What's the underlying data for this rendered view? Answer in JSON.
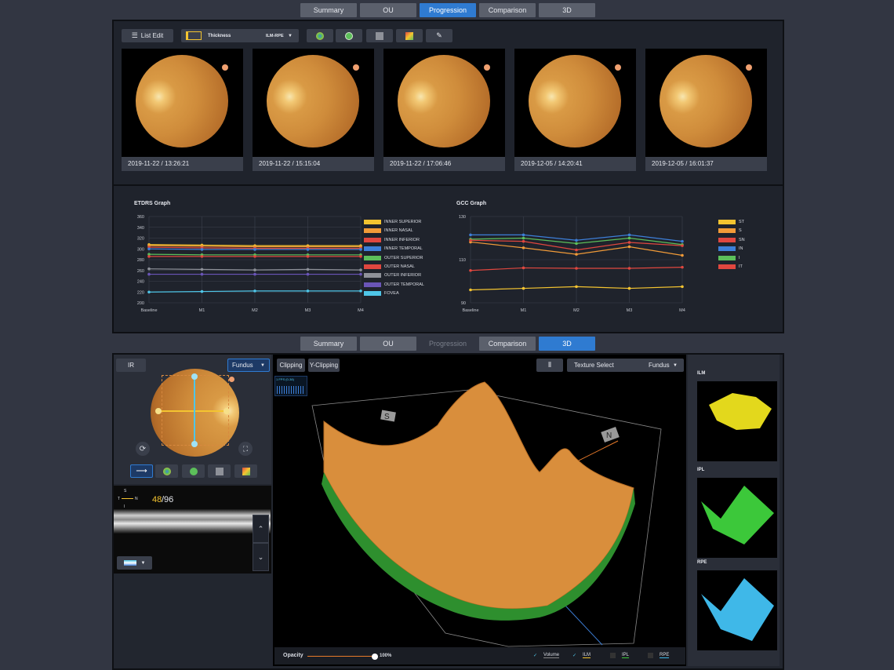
{
  "tabs_top": [
    {
      "label": "Summary",
      "state": "normal"
    },
    {
      "label": "OU",
      "state": "normal"
    },
    {
      "label": "Progression",
      "state": "active"
    },
    {
      "label": "Comparison",
      "state": "normal"
    },
    {
      "label": "3D",
      "state": "normal"
    }
  ],
  "tabs_bottom": [
    {
      "label": "Summary",
      "state": "normal"
    },
    {
      "label": "OU",
      "state": "normal"
    },
    {
      "label": "Progression",
      "state": "disabled"
    },
    {
      "label": "Comparison",
      "state": "normal"
    },
    {
      "label": "3D",
      "state": "active"
    }
  ],
  "toolbar": {
    "list_edit_label": "List Edit",
    "thickness_label": "Thickness",
    "layer_value": "ILM-RPE"
  },
  "thumbnails": [
    {
      "caption": "2019-11-22 / 13:26:21"
    },
    {
      "caption": "2019-11-22 / 15:15:04"
    },
    {
      "caption": "2019-11-22 / 17:06:46"
    },
    {
      "caption": "2019-12-05 / 14:20:41"
    },
    {
      "caption": "2019-12-05 / 16:01:37"
    }
  ],
  "chart_data": [
    {
      "type": "line",
      "title": "ETDRS Graph",
      "x": [
        "Baseline",
        "M1",
        "M2",
        "M3",
        "M4"
      ],
      "yticks": [
        200,
        220,
        240,
        260,
        280,
        300,
        320,
        340,
        360
      ],
      "ylim": [
        200,
        360
      ],
      "grid": true,
      "legend_position": "right",
      "series": [
        {
          "name": "INNER SUPERIOR",
          "color": "#f4c430",
          "values": [
            308,
            307,
            306,
            306,
            306
          ]
        },
        {
          "name": "INNER NASAL",
          "color": "#f29b38",
          "values": [
            306,
            305,
            304,
            304,
            304
          ]
        },
        {
          "name": "INNER INFERIOR",
          "color": "#e0473f",
          "values": [
            303,
            302,
            301,
            301,
            301
          ]
        },
        {
          "name": "INNER TEMPORAL",
          "color": "#3d7fd9",
          "values": [
            300,
            299,
            299,
            299,
            299
          ]
        },
        {
          "name": "OUTER SUPERIOR",
          "color": "#5cbf5a",
          "values": [
            290,
            289,
            289,
            289,
            289
          ]
        },
        {
          "name": "OUTER NASAL",
          "color": "#e0473f",
          "values": [
            286,
            286,
            286,
            286,
            286
          ]
        },
        {
          "name": "OUTER INFERIOR",
          "color": "#8e9199",
          "values": [
            263,
            262,
            261,
            262,
            261
          ]
        },
        {
          "name": "OUTER TEMPORAL",
          "color": "#6a55b8",
          "values": [
            253,
            253,
            253,
            253,
            253
          ]
        },
        {
          "name": "FOVEA",
          "color": "#4fc6e8",
          "values": [
            220,
            221,
            222,
            222,
            222
          ]
        }
      ]
    },
    {
      "type": "line",
      "title": "GCC Graph",
      "x": [
        "Baseline",
        "M1",
        "M2",
        "M3",
        "M4"
      ],
      "yticks": [
        90,
        110,
        130
      ],
      "ylim": [
        90,
        130
      ],
      "grid": true,
      "legend_position": "right",
      "series": [
        {
          "name": "ST",
          "color": "#f4c430",
          "values": [
            96,
            96.7,
            97.5,
            96.7,
            97.5
          ]
        },
        {
          "name": "S",
          "color": "#f29b38",
          "values": [
            118.2,
            115.5,
            112.5,
            116,
            112
          ]
        },
        {
          "name": "SN",
          "color": "#e0473f",
          "values": [
            105,
            106.2,
            106,
            106,
            106.5
          ]
        },
        {
          "name": "IN",
          "color": "#3d7fd9",
          "values": [
            121.5,
            121.5,
            119,
            121.5,
            118.5
          ]
        },
        {
          "name": "I",
          "color": "#5cbf5a",
          "values": [
            119.5,
            120,
            117.5,
            120,
            117
          ]
        },
        {
          "name": "IT",
          "color": "#e0473f",
          "values": [
            119,
            118.5,
            114.5,
            118,
            116.5
          ]
        }
      ]
    }
  ],
  "left_panel": {
    "ir_label": "IR",
    "fundus_select": "Fundus",
    "bscan_current": "48",
    "bscan_total": "/96",
    "orient_s": "S",
    "orient_t": "T",
    "orient_n": "N",
    "orient_i": "I"
  },
  "viewer": {
    "clipping_label": "Clipping",
    "yclipping_label": "Y-Clipping",
    "texture_label": "Texture Select",
    "texture_value": "Fundus",
    "fps_label": "1 FPS (0-38)",
    "axis_s": "S",
    "axis_n": "N",
    "opacity_label": "Opacity",
    "opacity_value": "100%",
    "opacity_fraction": 1.0,
    "checks": [
      {
        "label": "Volume",
        "checked": true
      },
      {
        "label": "ILM",
        "checked": true
      },
      {
        "label": "IPL",
        "checked": false
      },
      {
        "label": "RPE",
        "checked": false
      }
    ]
  },
  "layers": [
    {
      "label": "ILM",
      "color": "#e3d81c"
    },
    {
      "label": "IPL",
      "color": "#3cc83a"
    },
    {
      "label": "RPE",
      "color": "#3fb8e8"
    }
  ]
}
